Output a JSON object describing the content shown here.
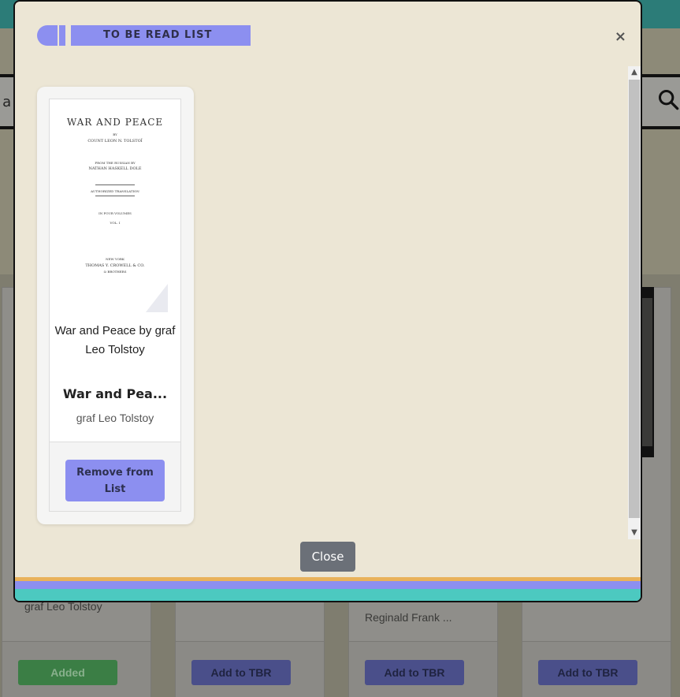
{
  "modal": {
    "title": "TO BE READ LIST",
    "close_symbol": "×",
    "close_button": "Close"
  },
  "book": {
    "label": "War and Peace by graf Leo Tolstoy",
    "title": "War and Pea...",
    "author": "graf Leo Tolstoy",
    "remove_button": "Remove from List",
    "cover": {
      "title": "WAR AND PEACE",
      "by": "BY",
      "author": "COUNT LEON N. TOLSTOÏ",
      "from": "FROM THE RUSSIAN BY",
      "translator": "NATHAN HASKELL DOLE",
      "edition": "AUTHORIZED TRANSLATION",
      "volumes": "IN FOUR VOLUMES",
      "vol": "VOL. I",
      "city": "NEW YORK",
      "publisher": "THOMAS Y. CROWELL & CO.",
      "publisher_line": "& BROTHERS"
    }
  },
  "background": {
    "search_fragment": "r a",
    "cards": [
      {
        "author_line": "graf Leo Tolstoy",
        "button": "Added"
      },
      {
        "author_line": "",
        "button": "Add to TBR"
      },
      {
        "author_line": "Reginald Frank ...",
        "button": "Add to TBR"
      },
      {
        "author_line": "",
        "button": "Add to TBR"
      }
    ]
  },
  "colors": {
    "accent": "#8c8ff0",
    "modal_bg": "#ece6d5",
    "stripe_orange": "#e9b25a",
    "stripe_purple": "#8c8ff0",
    "stripe_teal": "#4cc9c0",
    "added_green": "#3b7e45"
  }
}
